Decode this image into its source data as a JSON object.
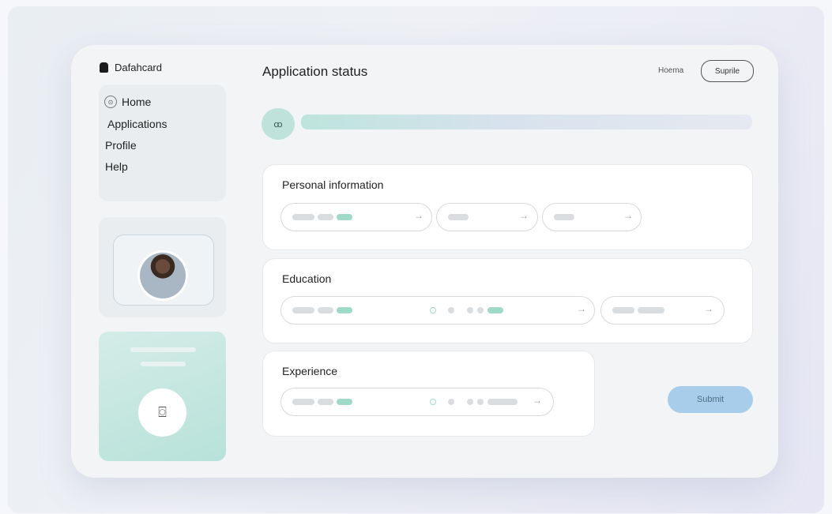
{
  "brand": {
    "name": "Dafahcard"
  },
  "nav": {
    "items": [
      {
        "label": "Home"
      },
      {
        "label": "Applications"
      },
      {
        "label": "Profile"
      },
      {
        "label": "Help"
      }
    ]
  },
  "header": {
    "title": "Application status",
    "home_link": "Hoema",
    "pill_button": "Suprile"
  },
  "progress": {
    "badge": "ꝏ"
  },
  "sections": [
    {
      "title": "Personal information"
    },
    {
      "title": "Education"
    },
    {
      "title": "Experience"
    }
  ],
  "actions": {
    "submit": "Submit"
  },
  "icons": {
    "arrow": "→",
    "upload": "⌼"
  },
  "colors": {
    "accent_green": "#9fdac8",
    "submit_blue": "#a7cdea"
  }
}
